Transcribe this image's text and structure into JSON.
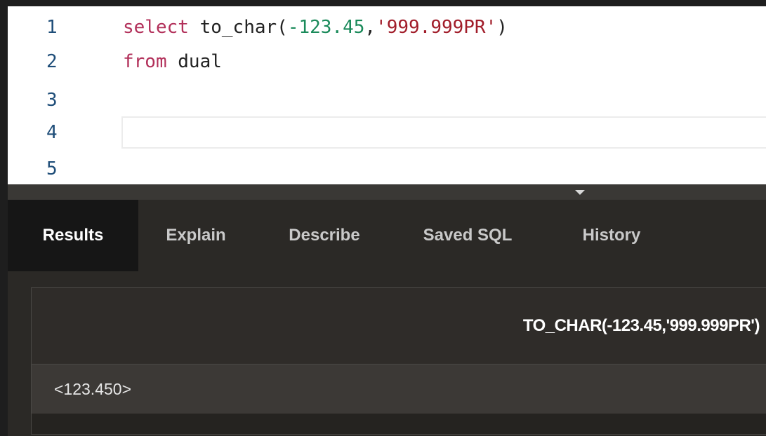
{
  "editor": {
    "lines": [
      {
        "number": "1",
        "tokens": [
          {
            "text": "select",
            "kind": "kw"
          },
          {
            "text": " to_char(",
            "kind": "plain"
          },
          {
            "text": "-123.45",
            "kind": "num"
          },
          {
            "text": ",",
            "kind": "plain"
          },
          {
            "text": "'999.999PR'",
            "kind": "str"
          },
          {
            "text": ")",
            "kind": "plain"
          }
        ]
      },
      {
        "number": "2",
        "tokens": [
          {
            "text": "from",
            "kind": "kw"
          },
          {
            "text": " dual",
            "kind": "plain"
          }
        ]
      },
      {
        "number": "3",
        "tokens": []
      },
      {
        "number": "4",
        "tokens": []
      },
      {
        "number": "5",
        "tokens": []
      }
    ],
    "colors": {
      "keyword": "#b2305a",
      "number": "#1a8a5a",
      "string": "#a11d2a",
      "line_number": "#1f4e79"
    }
  },
  "tabs": {
    "active": "Results",
    "items": [
      "Results",
      "Explain",
      "Describe",
      "Saved SQL",
      "History"
    ]
  },
  "results": {
    "columns": [
      "TO_CHAR(-123.45,'999.999PR')"
    ],
    "rows": [
      [
        "<123.450>"
      ]
    ]
  }
}
